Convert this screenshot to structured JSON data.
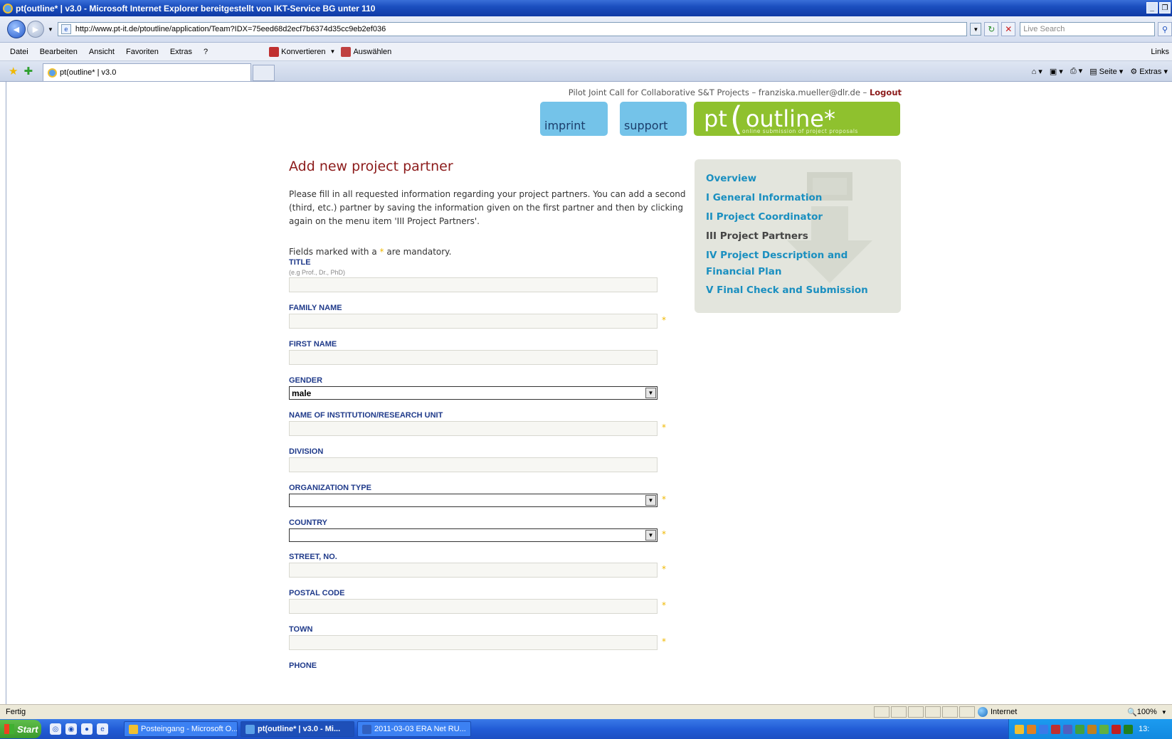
{
  "window": {
    "title": "pt(outline* | v3.0 - Microsoft Internet Explorer bereitgestellt von IKT-Service BG unter 110"
  },
  "address": {
    "url": "http://www.pt-it.de/ptoutline/application/Team?IDX=75eed68d2ecf7b6374d35cc9eb2ef036",
    "search_placeholder": "Live Search"
  },
  "menu": {
    "items": [
      "Datei",
      "Bearbeiten",
      "Ansicht",
      "Favoriten",
      "Extras",
      "?"
    ],
    "tool_konvertieren": "Konvertieren",
    "tool_auswaehlen": "Auswählen",
    "links": "Links"
  },
  "tabs": {
    "active_label": "pt(outline* | v3.0",
    "tools": [
      "Seite",
      "Extras"
    ]
  },
  "page": {
    "topline": "Pilot Joint Call for Collaborative S&T Projects – franziska.mueller@dlr.de –",
    "logout": "Logout",
    "tiles": {
      "imprint": "imprint",
      "support": "support"
    },
    "logo": {
      "pt": "pt",
      "bracket": "(",
      "word": "outline*",
      "subline": "online submission of project proposals"
    },
    "title": "Add new project partner",
    "intro": "Please fill in all requested information regarding your project partners. You can add a second (third, etc.) partner by saving the information given on the first partner and then by clicking again on the menu item 'III Project Partners'.",
    "mandatory_prefix": "Fields marked with a",
    "mandatory_star": "*",
    "mandatory_suffix": "are mandatory.",
    "required_mark": "*",
    "fields": {
      "title": {
        "label": "TITLE",
        "hint": "(e.g Prof., Dr., PhD)",
        "value": ""
      },
      "family_name": {
        "label": "FAMILY NAME",
        "value": ""
      },
      "first_name": {
        "label": "FIRST NAME",
        "value": ""
      },
      "gender": {
        "label": "GENDER",
        "value": "male"
      },
      "institution": {
        "label": "NAME OF INSTITUTION/RESEARCH UNIT",
        "value": ""
      },
      "division": {
        "label": "DIVISION",
        "value": ""
      },
      "org_type": {
        "label": "ORGANIZATION TYPE",
        "value": ""
      },
      "country": {
        "label": "COUNTRY",
        "value": ""
      },
      "street": {
        "label": "STREET, NO.",
        "value": ""
      },
      "postal_code": {
        "label": "POSTAL CODE",
        "value": ""
      },
      "town": {
        "label": "TOWN",
        "value": ""
      },
      "phone": {
        "label": "PHONE"
      }
    },
    "sidebar": {
      "items": [
        {
          "label": "Overview",
          "current": false
        },
        {
          "label": "I General Information",
          "current": false
        },
        {
          "label": "II Project Coordinator",
          "current": false
        },
        {
          "label": "III Project Partners",
          "current": true
        },
        {
          "label": "IV Project Description and Financial Plan",
          "current": false
        },
        {
          "label": "V Final Check and Submission",
          "current": false
        }
      ]
    }
  },
  "statusbar": {
    "status": "Fertig",
    "zone": "Internet",
    "zoom": "100%"
  },
  "taskbar": {
    "start": "Start",
    "tasks": [
      {
        "label": "Posteingang - Microsoft O...",
        "active": false
      },
      {
        "label": "pt(outline* | v3.0 - Mi...",
        "active": true
      },
      {
        "label": "2011-03-03 ERA Net RU...",
        "active": false
      }
    ],
    "clock": "13:"
  },
  "colors": {
    "accent_title": "#8c1b1b",
    "link_blue": "#1a8fc0",
    "label_blue": "#1f3a8a",
    "tile_blue": "#74c3e9",
    "logo_green": "#8fc12e",
    "required_star": "#f0b800"
  }
}
